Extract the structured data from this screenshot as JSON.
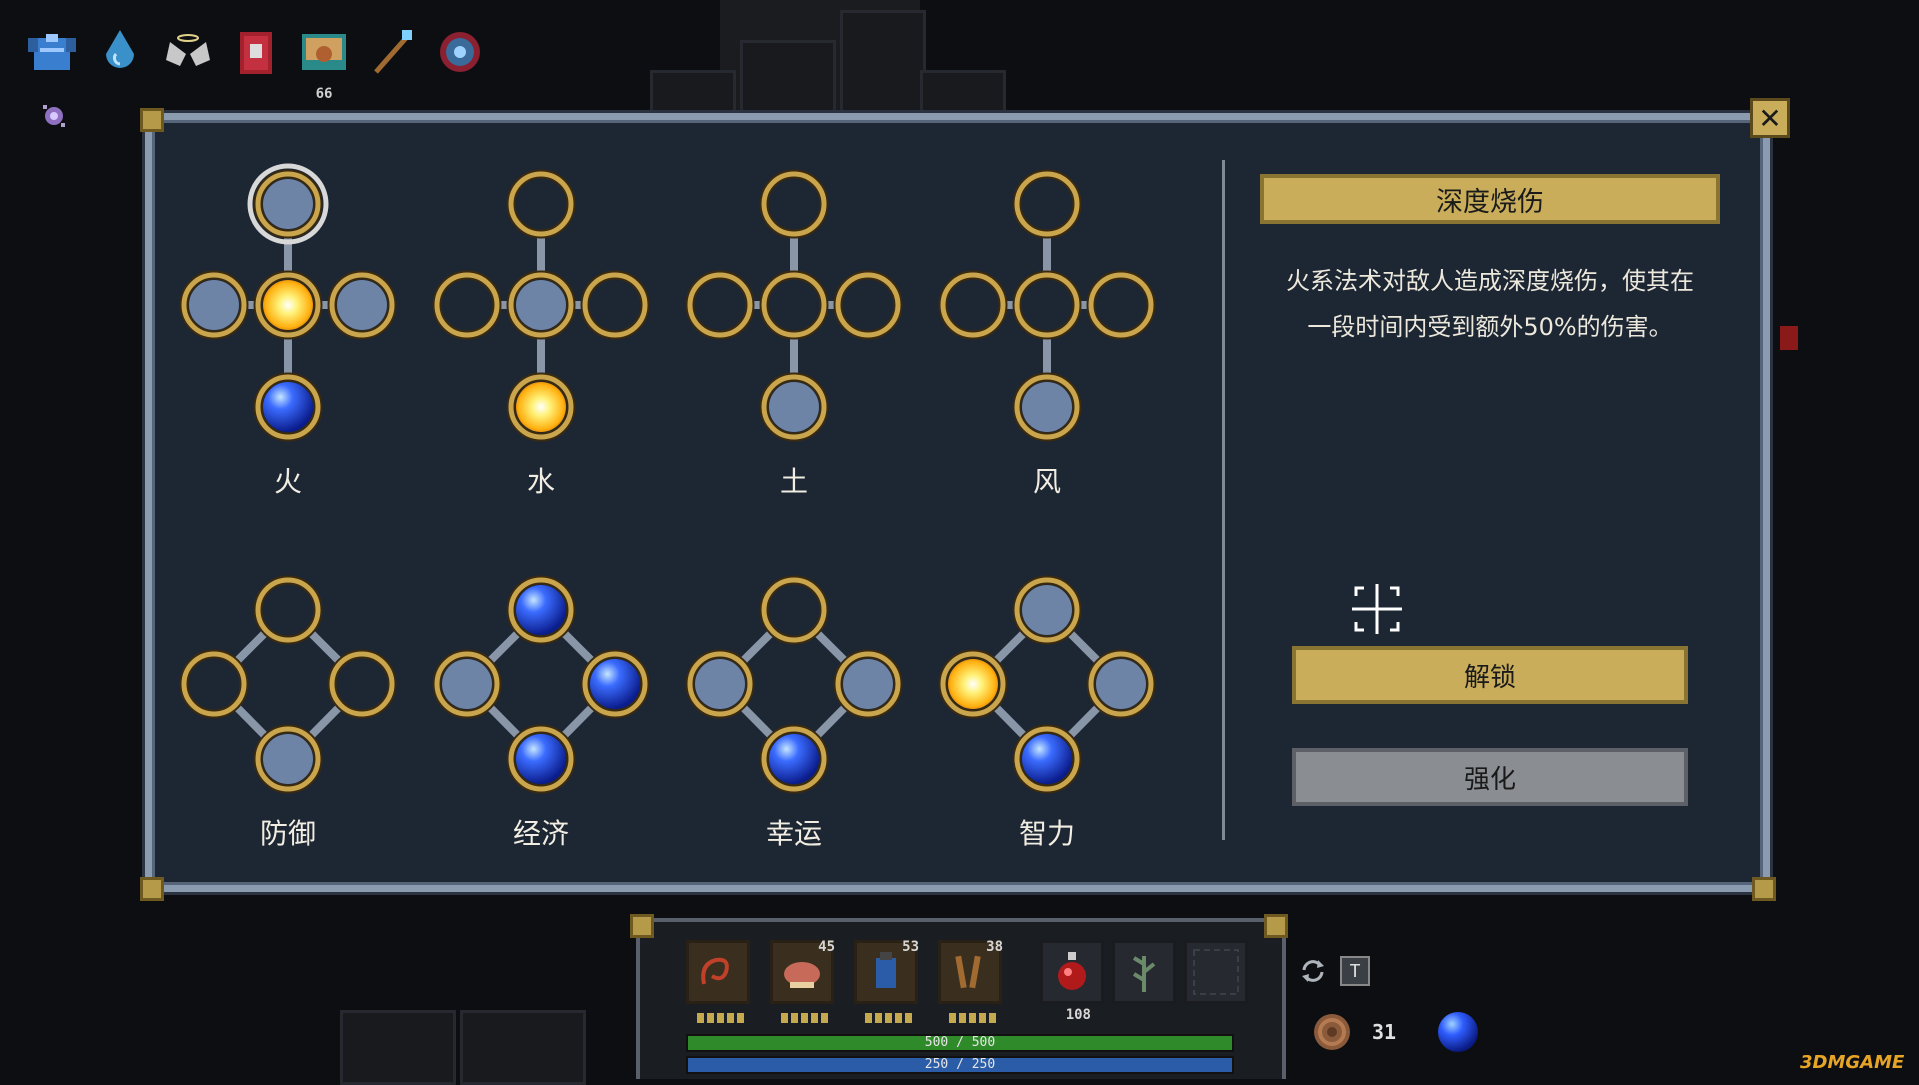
{
  "colors": {
    "gold": "#c9ad5b",
    "panel_bg": "#1d2633",
    "node_empty": "#6d84a6",
    "node_ring": "#c9a54d",
    "orb_blue": "#2f5dff",
    "orb_fire": "#ffd22a"
  },
  "top_inventory": [
    {
      "icon": "armor-icon",
      "count": ""
    },
    {
      "icon": "water-drop-icon",
      "count": ""
    },
    {
      "icon": "wings-icon",
      "count": ""
    },
    {
      "icon": "spellbook-icon",
      "count": ""
    },
    {
      "icon": "scroll-map-icon",
      "count": "66"
    },
    {
      "icon": "staff-icon",
      "count": ""
    },
    {
      "icon": "rune-gear-icon",
      "count": ""
    }
  ],
  "close_label": "✕",
  "skill_groups": [
    {
      "name": "火",
      "layout": "cross",
      "nodes": [
        "selected",
        "empty",
        "fire",
        "empty",
        "blue"
      ]
    },
    {
      "name": "水",
      "layout": "cross",
      "nodes": [
        "hollow",
        "hollow",
        "empty",
        "hollow",
        "fire"
      ]
    },
    {
      "name": "土",
      "layout": "cross",
      "nodes": [
        "hollow",
        "hollow",
        "hollow",
        "hollow",
        "empty"
      ]
    },
    {
      "name": "风",
      "layout": "cross",
      "nodes": [
        "hollow",
        "hollow",
        "hollow",
        "hollow",
        "empty"
      ]
    },
    {
      "name": "防御",
      "layout": "diamond",
      "nodes": [
        "hollow",
        "hollow",
        "hollow",
        "empty"
      ]
    },
    {
      "name": "经济",
      "layout": "diamond",
      "nodes": [
        "blue",
        "empty",
        "blue",
        "blue"
      ]
    },
    {
      "name": "幸运",
      "layout": "diamond",
      "nodes": [
        "hollow",
        "empty",
        "empty",
        "blue"
      ]
    },
    {
      "name": "智力",
      "layout": "diamond",
      "nodes": [
        "empty",
        "fire",
        "empty",
        "blue"
      ]
    }
  ],
  "detail": {
    "title": "深度烧伤",
    "desc_line1": "火系法术对敌人造成深度烧伤，使其在",
    "desc_line2": "一段时间内受到额外50%的伤害。",
    "unlock_label": "解锁",
    "upgrade_label": "强化"
  },
  "hud": {
    "slots": [
      {
        "icon": "whip-icon",
        "count": ""
      },
      {
        "icon": "meat-icon",
        "count": "45"
      },
      {
        "icon": "canteen-icon",
        "count": "53"
      },
      {
        "icon": "wood-icon",
        "count": "38"
      },
      {
        "icon": "health-potion-icon",
        "count": "108"
      },
      {
        "icon": "herb-icon",
        "count": ""
      },
      {
        "icon": "empty-slot-icon",
        "count": ""
      }
    ],
    "hp_text": "500 / 500",
    "hp_fraction": 1.0,
    "mp_text": "250 / 250",
    "mp_fraction": 1.0,
    "hotkey": "T",
    "coins": "31"
  },
  "watermark": "3DMGAME"
}
